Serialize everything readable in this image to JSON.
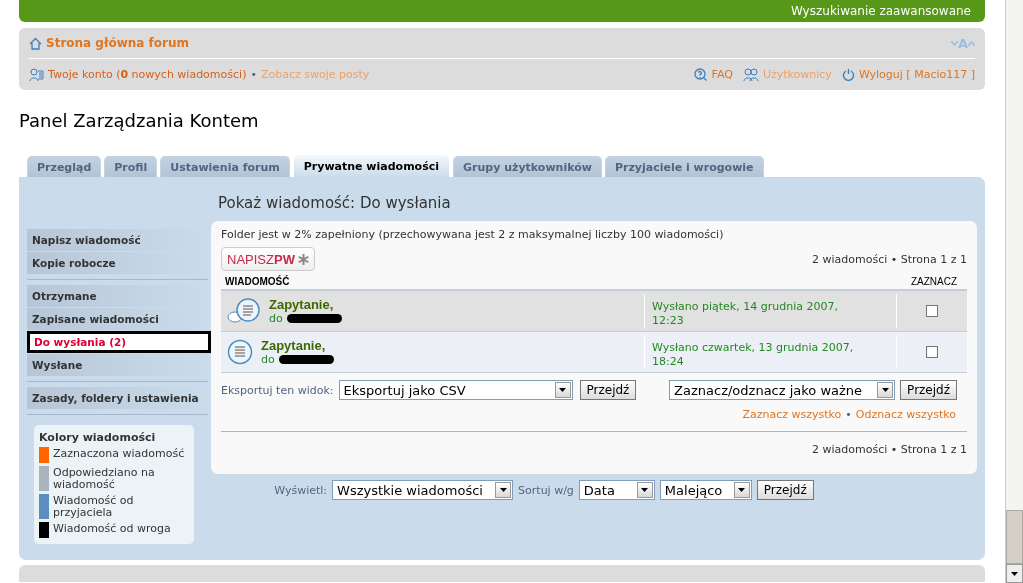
{
  "top_bar": {
    "link": "Wyszukiwanie zaawansowane"
  },
  "header": {
    "home_link": "Strona główna forum",
    "font_size_label": "A",
    "account": "Twoje konto (**0** nowych wiadomości)",
    "own_posts": "Zobacz swoje posty",
    "separator": "•",
    "faq": "FAQ",
    "users": "Użytkownicy",
    "logout": "Wyloguj [ Macio117 ]"
  },
  "title": "Panel Zarządzania Kontem",
  "tabs": [
    {
      "label": "Przegląd",
      "selected": false
    },
    {
      "label": "Profil",
      "selected": false
    },
    {
      "label": "Ustawienia forum",
      "selected": false
    },
    {
      "label": "Prywatne wiadomości",
      "selected": true
    },
    {
      "label": "Grupy użytkowników",
      "selected": false
    },
    {
      "label": "Przyjaciele i wrogowie",
      "selected": false
    }
  ],
  "sidebar": {
    "groups": [
      [
        {
          "label": "Napisz wiadomość",
          "selected": false
        },
        {
          "label": "Kopie robocze",
          "selected": false
        }
      ],
      [
        {
          "label": "Otrzymane",
          "selected": false
        },
        {
          "label": "Zapisane wiadomości",
          "selected": false
        },
        {
          "label": "Do wysłania (2)",
          "selected": true
        },
        {
          "label": "Wysłane",
          "selected": false
        }
      ],
      [
        {
          "label": "Zasady, foldery i ustawienia",
          "selected": false
        }
      ]
    ],
    "legend": {
      "title": "Kolory wiadomości",
      "items": [
        {
          "label": "Zaznaczona wiadomość",
          "color": "#ff6600"
        },
        {
          "label": "Odpowiedziano na wiadomość",
          "color": "#aab4be"
        },
        {
          "label": "Wiadomość od przyjaciela",
          "color": "#5c8fbf"
        },
        {
          "label": "Wiadomość od wroga",
          "color": "#000000"
        }
      ]
    }
  },
  "main": {
    "heading": "Pokaż wiadomość: Do wysłania",
    "folder_info": "Folder jest w 2% zapełniony (przechowywana jest 2 z maksymalnej liczby 100 wiadomości)",
    "compose_button": "NAPISZ**PW**",
    "pagination_top": "2 wiadomości • Strona 1 z 1",
    "columns": [
      "WIADOMOŚĆ",
      "ZAZNACZ"
    ],
    "rows": [
      {
        "kind": "replied",
        "subject": "Zapytanie,",
        "to": "do",
        "date": "Wysłano piątek, 14 grudnia 2007, 12:23",
        "checked": false
      },
      {
        "kind": "read",
        "subject": "Zapytanie,",
        "to": "do",
        "date": "Wysłano czwartek, 13 grudnia 2007, 18:24",
        "checked": false
      }
    ],
    "export": {
      "label": "Eksportuj ten widok:",
      "select": "Eksportuj jako CSV",
      "button": "Przejdź"
    },
    "mark": {
      "select": "Zaznacz/odznacz jako ważne",
      "button": "Przejdź"
    },
    "mark_all": "Zaznacz wszystko",
    "separator": "•",
    "unmark_all": "Odznacz wszystko",
    "pagination_bottom": "2 wiadomości • Strona 1 z 1"
  },
  "display_bar": {
    "label": "Wyświetl:",
    "filter": "Wszystkie wiadomości",
    "sort_label": "Sortuj w/g",
    "sort_key": "Data",
    "sort_dir": "Malejąco",
    "button": "Przejdź"
  }
}
